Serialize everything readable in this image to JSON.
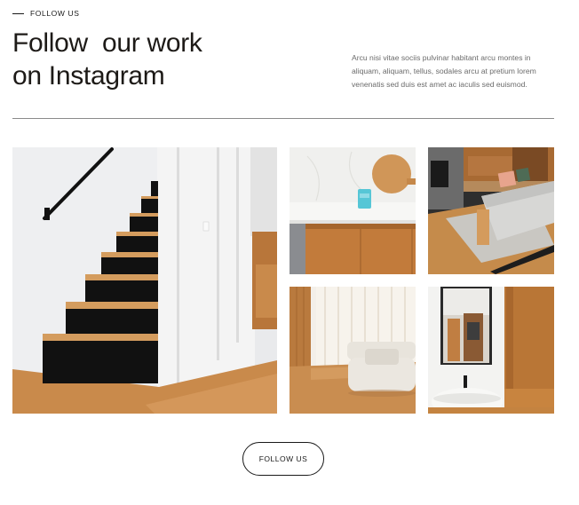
{
  "section": {
    "eyebrow": "FOLLOW US",
    "headline_line1": "Follow  our work",
    "headline_line2": "on Instagram",
    "description": "Arcu nisi vitae sociis pulvinar habitant arcu montes in aliquam, aliquam, tellus, sodales arcu at pretium lorem venenatis sed duis est amet ac iaculis sed euismod."
  },
  "gallery": {
    "items": [
      {
        "subject": "staircase"
      },
      {
        "subject": "kitchen-counter"
      },
      {
        "subject": "living-room-sofa"
      },
      {
        "subject": "bright-sofa-curtains"
      },
      {
        "subject": "bathroom-basin"
      }
    ]
  },
  "cta": {
    "label": "FOLLOW US"
  },
  "colors": {
    "text": "#1d1a17",
    "muted": "#6b6b6b",
    "wood": "#c98a4b",
    "divider": "#8a8a8a"
  }
}
